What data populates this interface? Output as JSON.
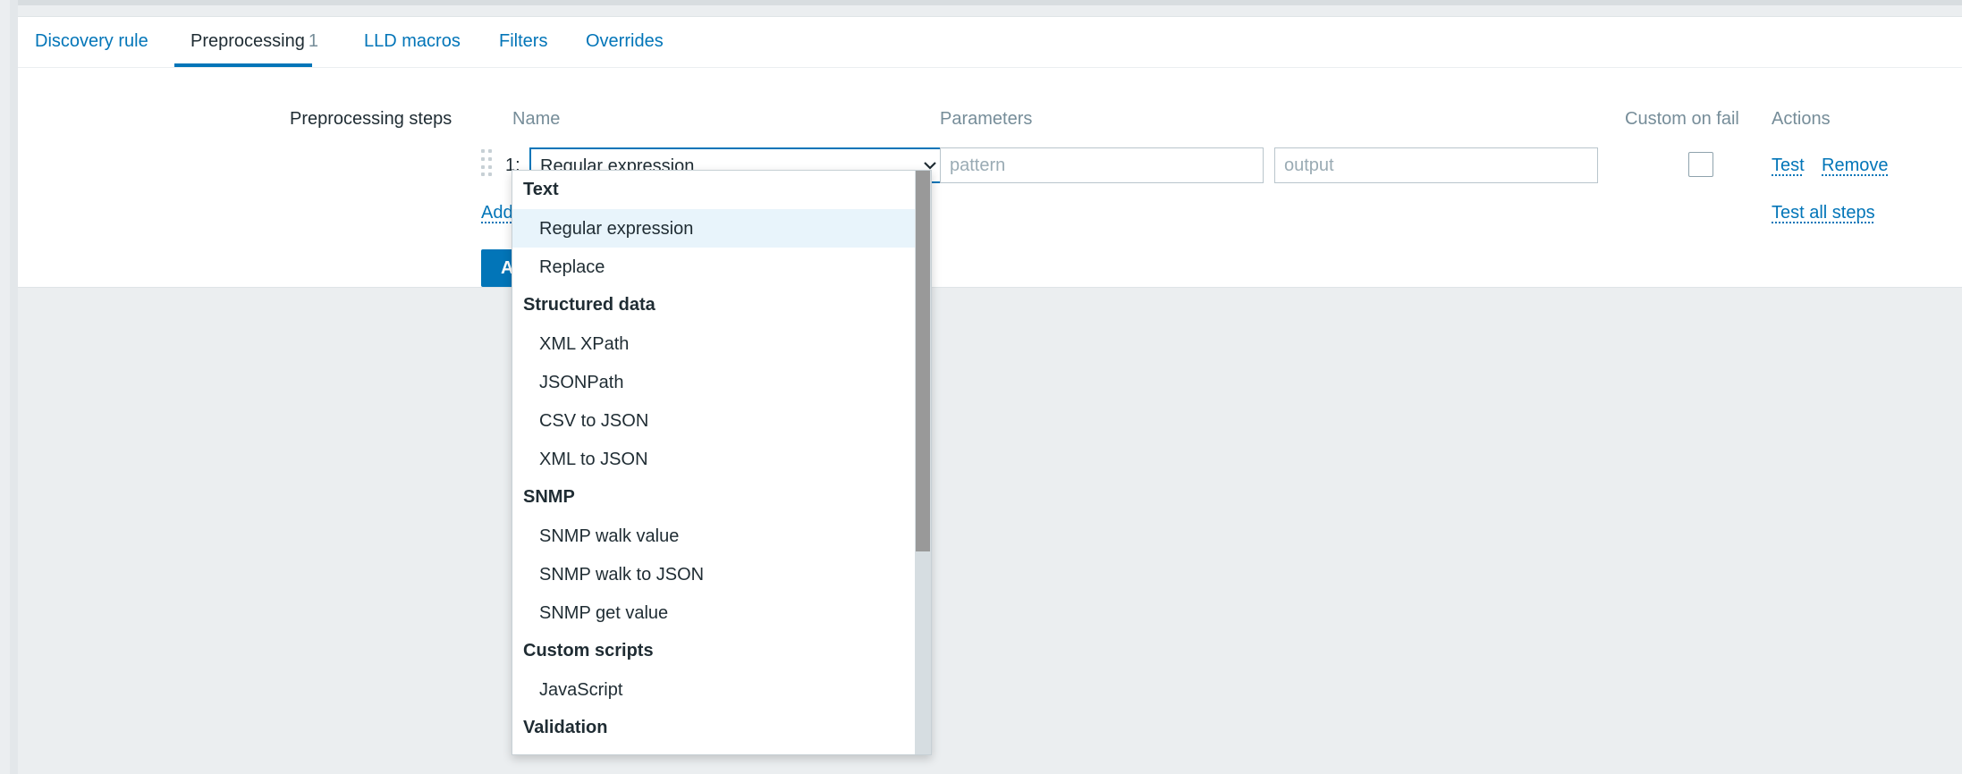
{
  "tabs": [
    {
      "label": "Discovery rule"
    },
    {
      "label": "Preprocessing",
      "count": "1"
    },
    {
      "label": "LLD macros"
    },
    {
      "label": "Filters"
    },
    {
      "label": "Overrides"
    }
  ],
  "form": {
    "label": "Preprocessing steps",
    "columns": {
      "name": "Name",
      "parameters": "Parameters",
      "custom_on_fail": "Custom on fail",
      "actions": "Actions"
    }
  },
  "step": {
    "number": "1:",
    "type_selected": "Regular expression",
    "param1_placeholder": "pattern",
    "param2_placeholder": "output",
    "test_label": "Test",
    "remove_label": "Remove"
  },
  "add_link": "Add",
  "test_all_label": "Test all steps",
  "add_button_label": "Add",
  "dropdown": {
    "groups": [
      {
        "label": "Text",
        "options": [
          "Regular expression",
          "Replace"
        ]
      },
      {
        "label": "Structured data",
        "options": [
          "XML XPath",
          "JSONPath",
          "CSV to JSON",
          "XML to JSON"
        ]
      },
      {
        "label": "SNMP",
        "options": [
          "SNMP walk value",
          "SNMP walk to JSON",
          "SNMP get value"
        ]
      },
      {
        "label": "Custom scripts",
        "options": [
          "JavaScript"
        ]
      },
      {
        "label": "Validation",
        "options": []
      }
    ],
    "selected": "Regular expression"
  },
  "colors": {
    "accent": "#0275b8",
    "background": "#ebeef0",
    "selected_row": "#e8f4fb"
  }
}
